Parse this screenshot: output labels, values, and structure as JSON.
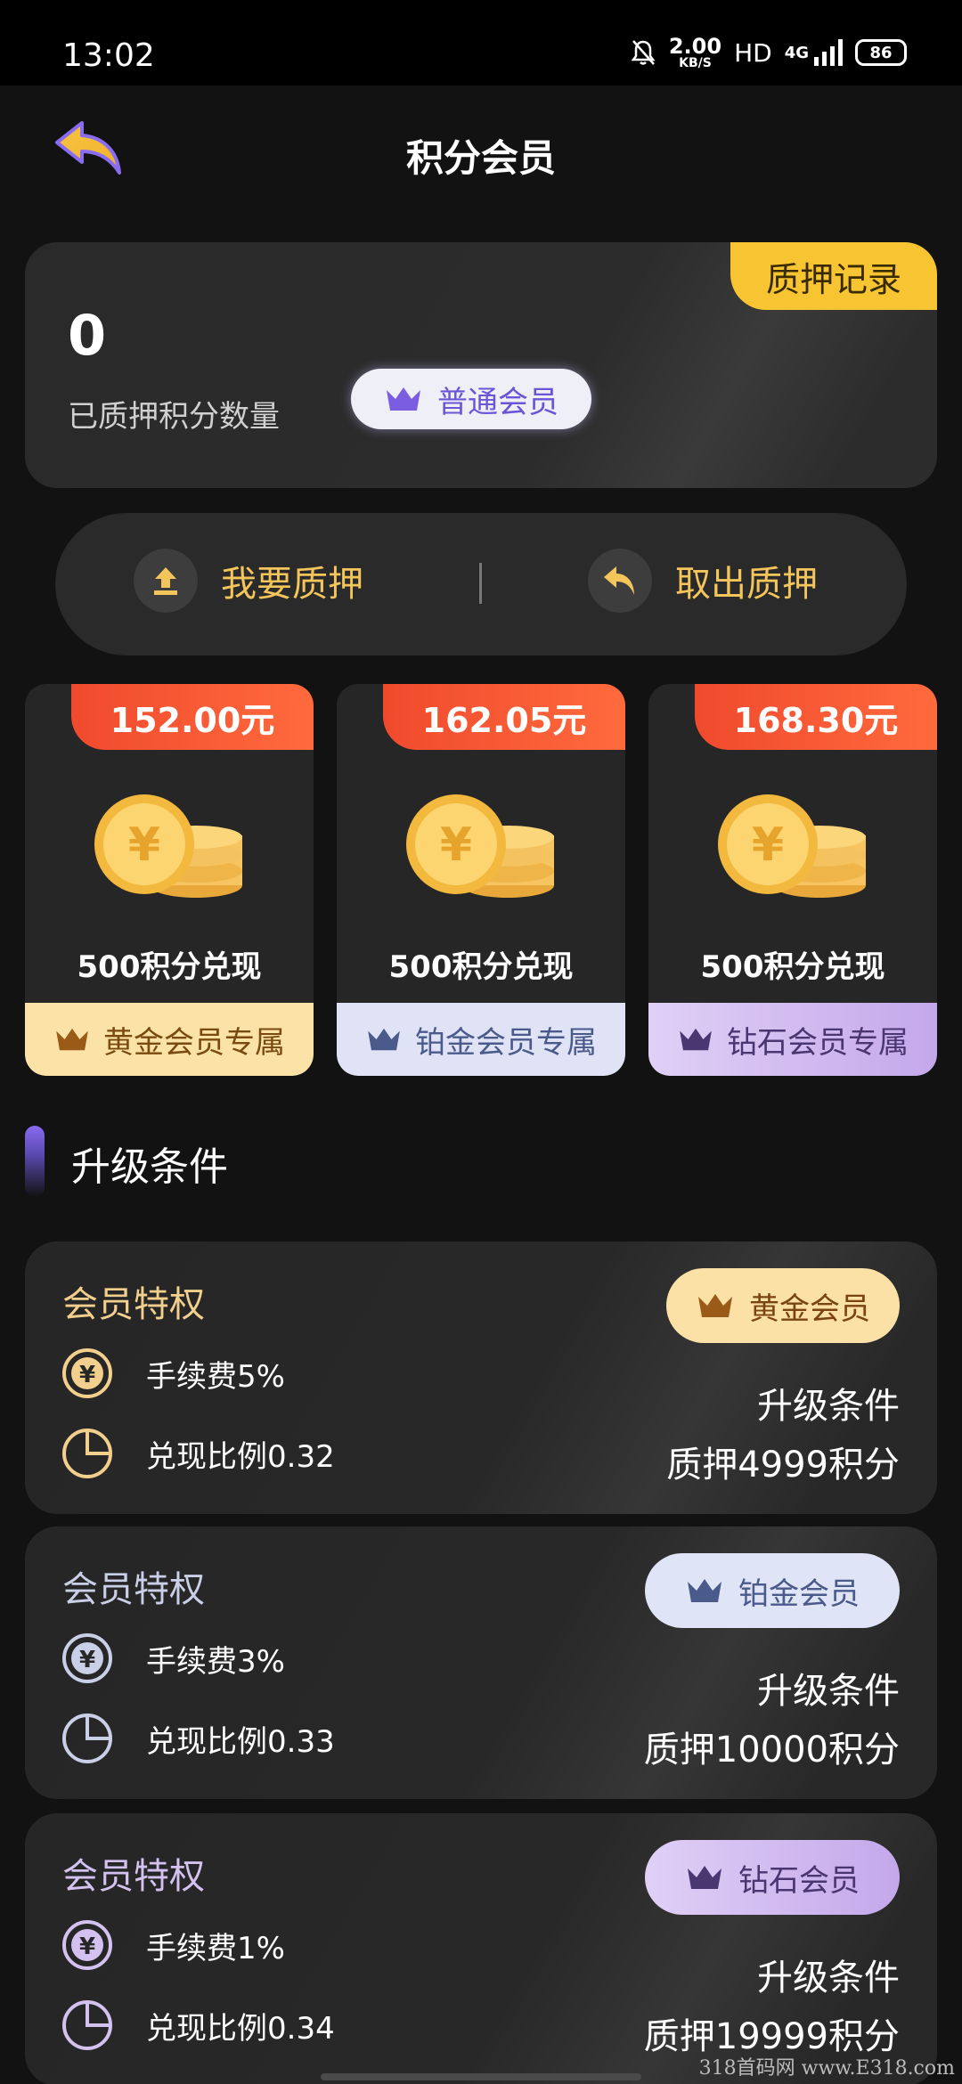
{
  "status_bar": {
    "time": "13:02",
    "speed_value": "2.00",
    "speed_unit": "KB/S",
    "hd": "HD",
    "network": "4G",
    "battery": "86"
  },
  "header": {
    "title": "积分会员"
  },
  "summary": {
    "record_button": "质押记录",
    "points_value": "0",
    "points_label": "已质押积分数量",
    "member_level": "普通会员"
  },
  "actions": {
    "pledge": "我要质押",
    "withdraw": "取出质押"
  },
  "offers": [
    {
      "price": "152.00元",
      "text": "500积分兑现",
      "tag": "黄金会员专属",
      "tag_bg": "#fbe3a8",
      "tag_color": "#7a4a10",
      "crown_color": "#9a5a18"
    },
    {
      "price": "162.05元",
      "text": "500积分兑现",
      "tag": "铂金会员专属",
      "tag_bg": "#dfe3f5",
      "tag_color": "#4a5a8a",
      "crown_color": "#4a5a8a"
    },
    {
      "price": "168.30元",
      "text": "500积分兑现",
      "tag": "钻石会员专属",
      "tag_bg": "#d6c4f0",
      "tag_color": "#4a3670",
      "crown_color": "#4a3670"
    }
  ],
  "section": {
    "title": "升级条件"
  },
  "tiers": [
    {
      "title": "会员特权",
      "title_color": "#f2cf8c",
      "fee": "手续费5%",
      "ratio": "兑现比例0.32",
      "badge": "黄金会员",
      "badge_bg": "#fbe1a6",
      "badge_color": "#7a4410",
      "icon_color": "#f2cf8c",
      "cond_label": "升级条件",
      "cond_value": "质押4999积分"
    },
    {
      "title": "会员特权",
      "title_color": "#c9cfe6",
      "fee": "手续费3%",
      "ratio": "兑现比例0.33",
      "badge": "铂金会员",
      "badge_bg": "#dfe4f6",
      "badge_color": "#4a5a8a",
      "icon_color": "#c9cfe6",
      "cond_label": "升级条件",
      "cond_value": "质押10000积分"
    },
    {
      "title": "会员特权",
      "title_color": "#d3c2f0",
      "fee": "手续费1%",
      "ratio": "兑现比例0.34",
      "badge": "钻石会员",
      "badge_bg": "#d8c6f2",
      "badge_color": "#4a3670",
      "icon_color": "#d3c2f0",
      "cond_label": "升级条件",
      "cond_value": "质押19999积分"
    }
  ],
  "watermark": "318首码网 www.E318.com",
  "colors": {
    "accent_gold": "#f3c55b",
    "record_bg": "#f7c531",
    "price_red": "#f04a2d",
    "member_purple": "#6b54d6"
  }
}
